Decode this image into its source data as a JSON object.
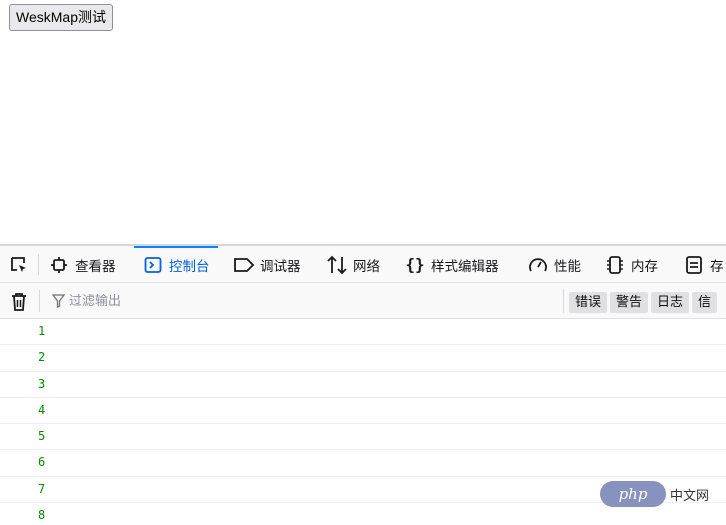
{
  "page": {
    "test_button_label": "WeskMap测试"
  },
  "devtools": {
    "tabs": [
      {
        "label": "查看器",
        "icon": "inspector-icon"
      },
      {
        "label": "控制台",
        "icon": "console-icon",
        "active": true
      },
      {
        "label": "调试器",
        "icon": "debugger-icon"
      },
      {
        "label": "网络",
        "icon": "network-icon"
      },
      {
        "label": "样式编辑器",
        "icon": "style-editor-icon"
      },
      {
        "label": "性能",
        "icon": "performance-icon"
      },
      {
        "label": "内存",
        "icon": "memory-icon"
      },
      {
        "label": "存",
        "icon": "storage-icon"
      }
    ],
    "toolbar": {
      "filter_placeholder": "过滤输出",
      "levels": [
        "错误",
        "警告",
        "日志",
        "信"
      ]
    },
    "log_lines": [
      "1",
      "2",
      "3",
      "4",
      "5",
      "6",
      "7",
      "8"
    ],
    "colors": {
      "accent": "#0a84ff",
      "log_value": "#058b00"
    }
  },
  "watermark": {
    "logo": "php",
    "text": "中文网"
  }
}
